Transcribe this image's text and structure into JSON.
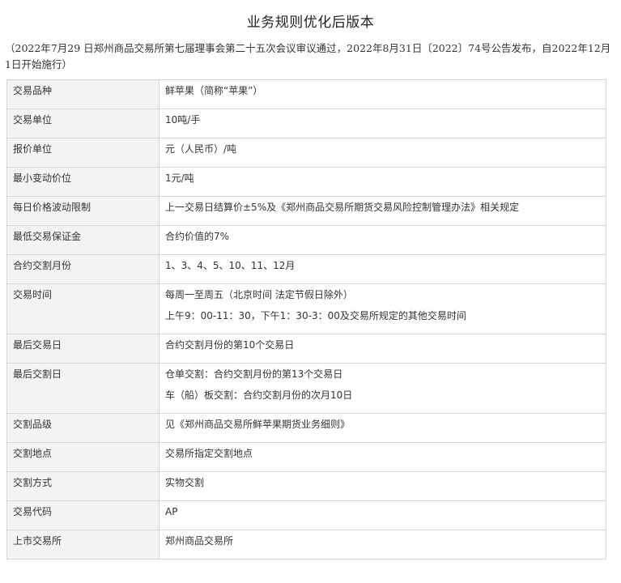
{
  "header": {
    "title": "业务规则优化后版本",
    "subtitle": "（2022年7月29 日郑州商品交易所第七届理事会第二十五次会议审议通过，2022年8月31日〔2022〕74号公告发布，自2022年12月1日开始施行）"
  },
  "table": {
    "rows": [
      {
        "key": "交易品种",
        "value": [
          "鲜苹果（简称“苹果”）"
        ]
      },
      {
        "key": "交易单位",
        "value": [
          "10吨/手"
        ]
      },
      {
        "key": "报价单位",
        "value": [
          "元（人民币）/吨"
        ]
      },
      {
        "key": "最小变动价位",
        "value": [
          "1元/吨"
        ]
      },
      {
        "key": "每日价格波动限制",
        "value": [
          "上一交易日结算价±5%及《郑州商品交易所期货交易风险控制管理办法》相关规定"
        ]
      },
      {
        "key": "最低交易保证金",
        "value": [
          "合约价值的7%"
        ]
      },
      {
        "key": "合约交割月份",
        "value": [
          "1、3、4、5、10、11、12月"
        ]
      },
      {
        "key": "交易时间",
        "value": [
          "每周一至周五（北京时间 法定节假日除外）",
          "上午9：00-11：30，下午1：30-3：00及交易所规定的其他交易时间"
        ]
      },
      {
        "key": "最后交易日",
        "value": [
          "合约交割月份的第10个交易日"
        ]
      },
      {
        "key": "最后交割日",
        "value": [
          "仓单交割：合约交割月份的第13个交易日",
          "车（船）板交割：合约交割月份的次月10日"
        ]
      },
      {
        "key": "交割品级",
        "value": [
          "见《郑州商品交易所鲜苹果期货业务细则》"
        ]
      },
      {
        "key": "交割地点",
        "value": [
          "交易所指定交割地点"
        ]
      },
      {
        "key": "交割方式",
        "value": [
          "实物交割"
        ]
      },
      {
        "key": "交易代码",
        "value": [
          "AP"
        ]
      },
      {
        "key": "上市交易所",
        "value": [
          "郑州商品交易所"
        ]
      }
    ]
  }
}
